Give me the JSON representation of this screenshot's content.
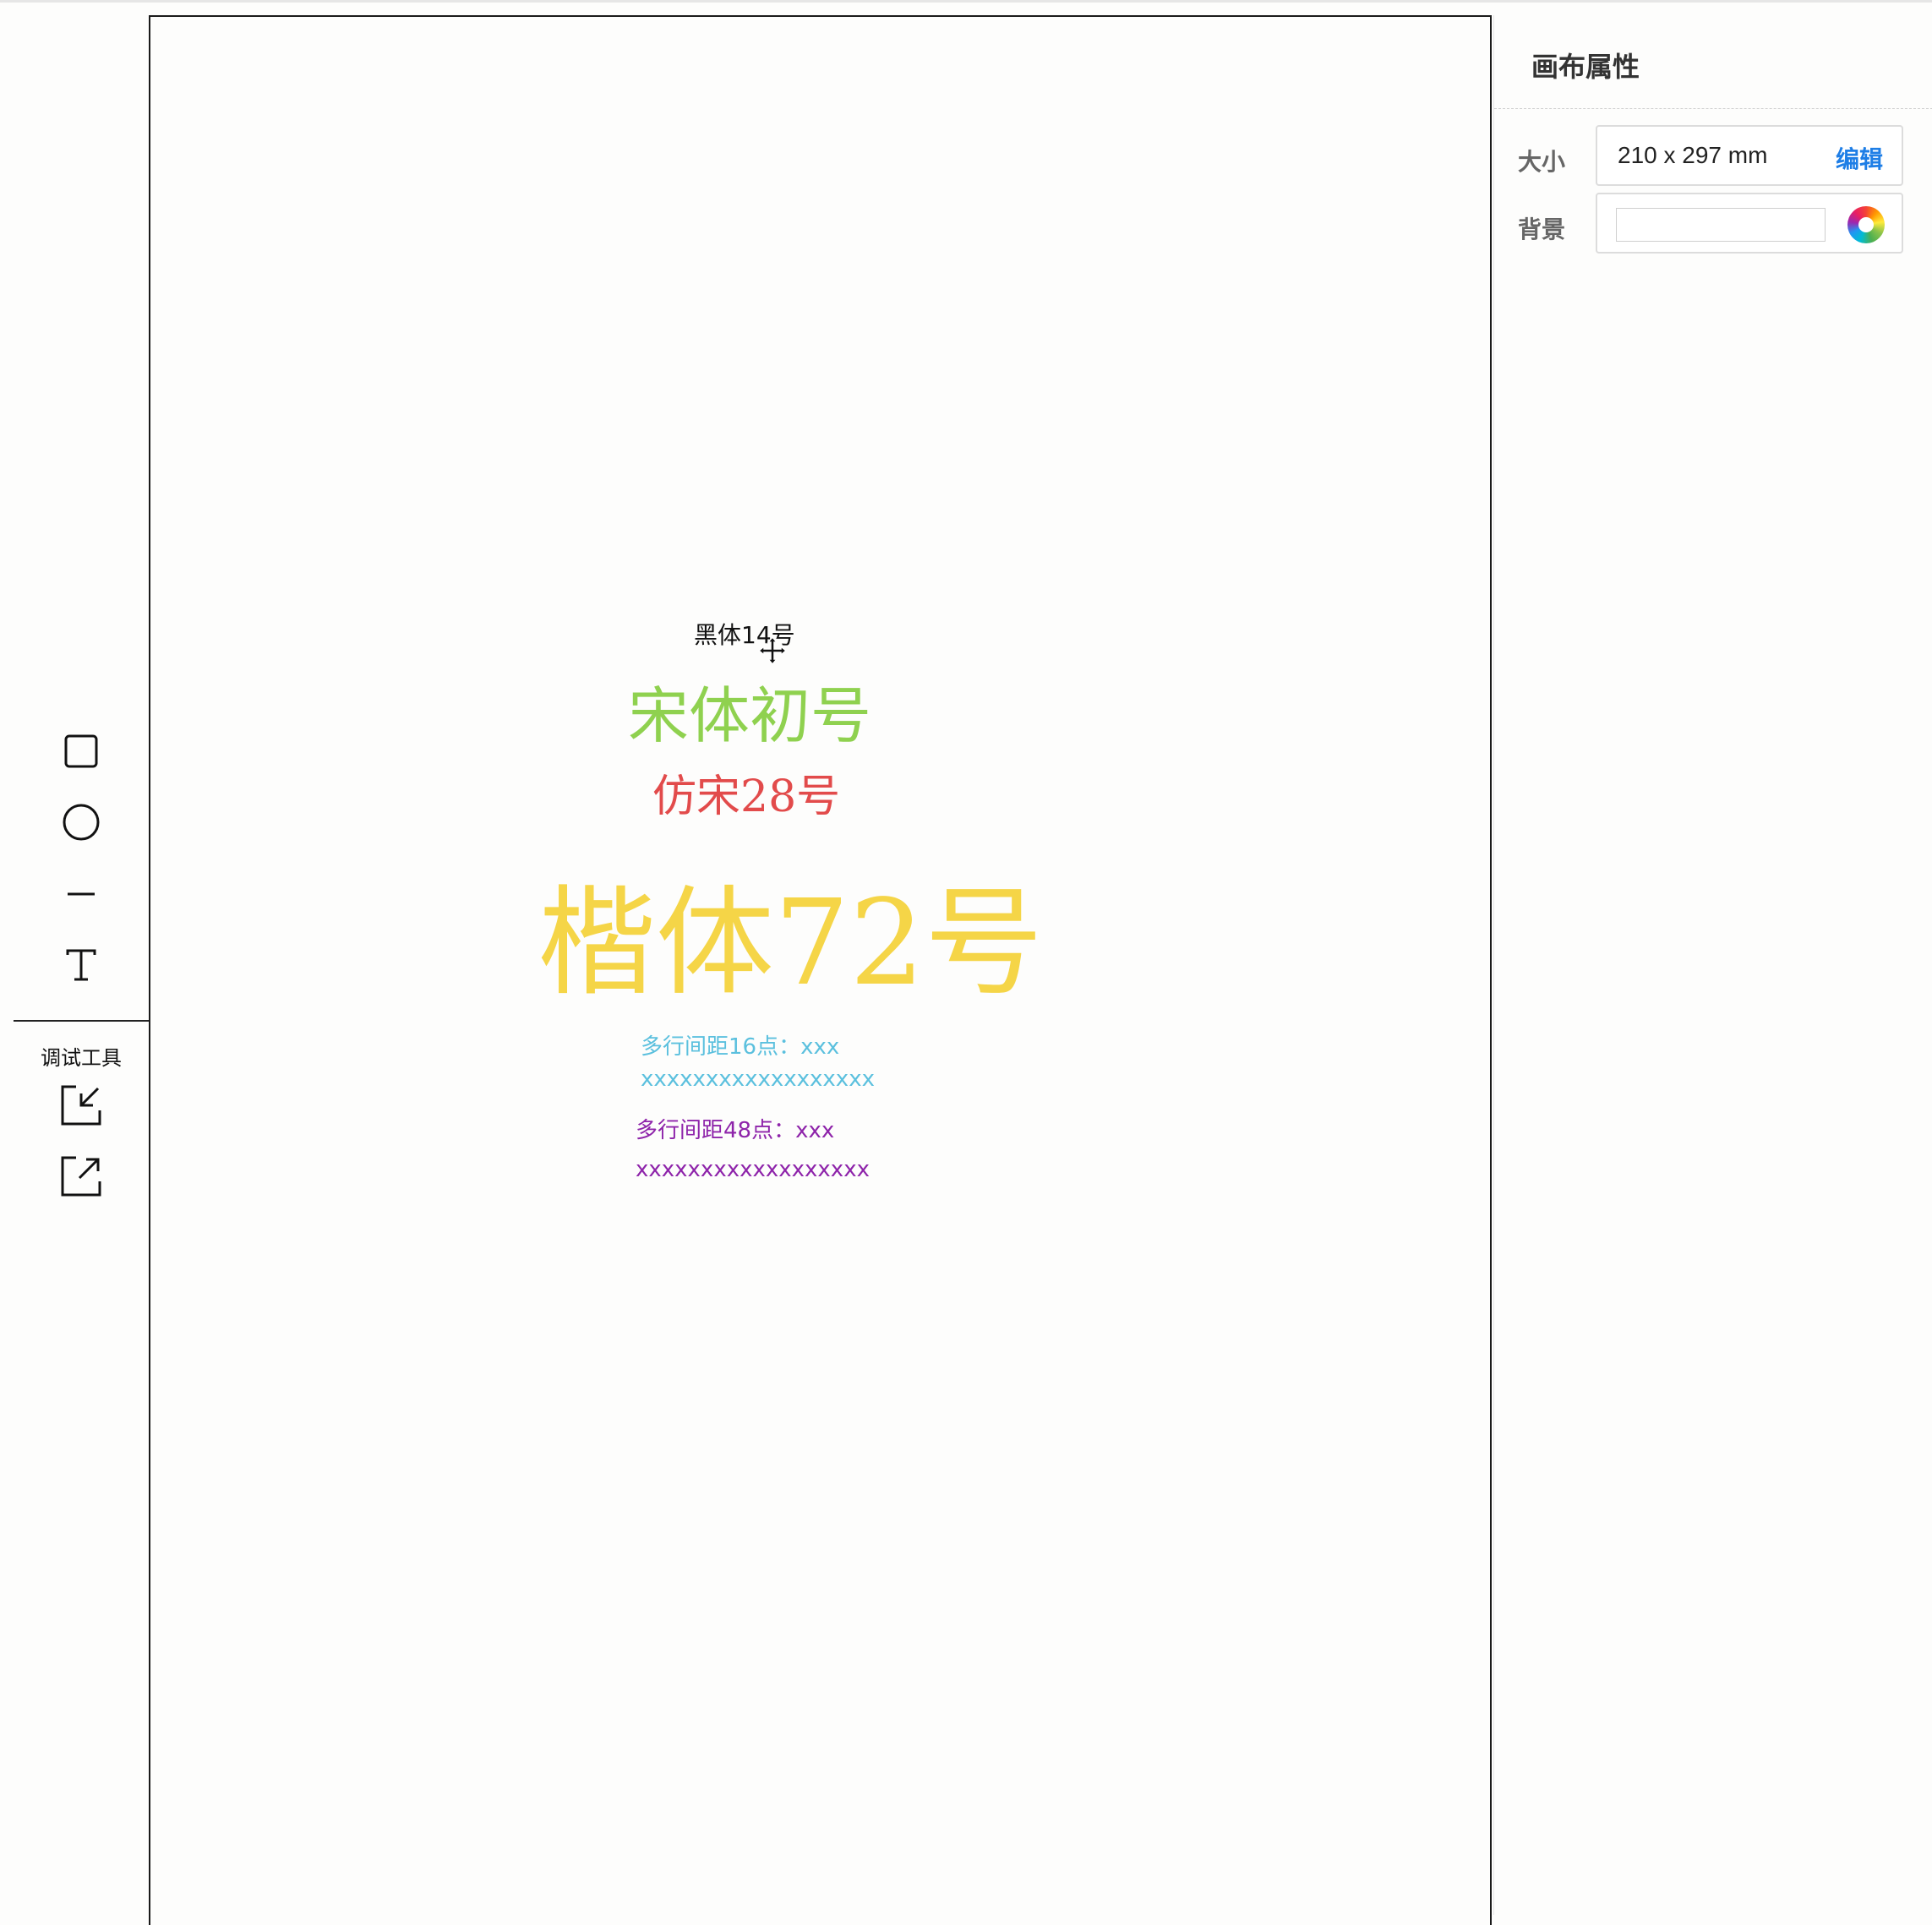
{
  "toolbar": {
    "tools": [
      {
        "name": "rectangle-tool",
        "icon": "square-icon"
      },
      {
        "name": "ellipse-tool",
        "icon": "circle-icon"
      },
      {
        "name": "line-tool",
        "icon": "line-icon"
      },
      {
        "name": "text-tool",
        "icon": "text-t-icon"
      }
    ],
    "debug_label": "调试工具",
    "debug_tools": [
      {
        "name": "import-tool",
        "icon": "import-arrow-icon"
      },
      {
        "name": "export-tool",
        "icon": "export-arrow-icon"
      }
    ]
  },
  "canvas": {
    "texts": {
      "heiti": "黑体14号",
      "songti": "宋体初号",
      "fangsong": "仿宋28号",
      "kaiti": "楷体72号",
      "multiline16_line1": "多行间距16点：xxx",
      "multiline16_line2": "xxxxxxxxxxxxxxxxxx",
      "multiline48_line1": "多行间距48点：xxx",
      "multiline48_line2": "xxxxxxxxxxxxxxxxxx"
    },
    "colors": {
      "songti": "#8fd14f",
      "fangsong": "#e24b4b",
      "kaiti": "#f5d547",
      "multiline16": "#5bc0de",
      "multiline48": "#8e24aa"
    }
  },
  "panel": {
    "title": "画布属性",
    "size_label": "大小",
    "size_value": "210 x 297 mm",
    "edit_label": "编辑",
    "background_label": "背景",
    "background_value": ""
  }
}
